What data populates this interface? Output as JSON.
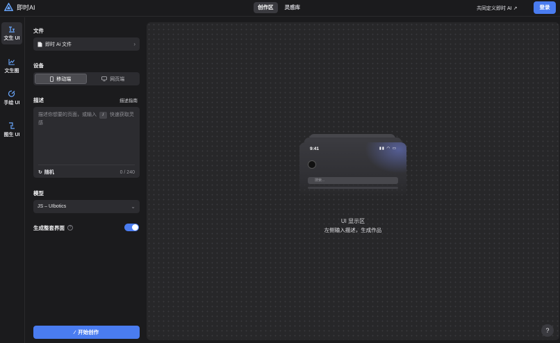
{
  "app": {
    "name": "即时AI"
  },
  "topnav": {
    "tabs": [
      {
        "label": "创作区",
        "active": true
      },
      {
        "label": "灵感库",
        "active": false
      }
    ]
  },
  "header": {
    "custom_link": "共同定义即时 AI",
    "login_label": "登录"
  },
  "rail": {
    "items": [
      {
        "label": "文生 UI",
        "icon": "text-to-ui-icon",
        "active": true
      },
      {
        "label": "文生图",
        "icon": "image-gen-icon",
        "active": false
      },
      {
        "label": "手绘 UI",
        "icon": "sketch-icon",
        "active": false
      },
      {
        "label": "图生 UI",
        "icon": "image-to-ui-icon",
        "active": false
      }
    ]
  },
  "panel": {
    "file": {
      "title": "文件",
      "value": "即时 Ai 文件"
    },
    "device": {
      "title": "设备",
      "options": [
        {
          "label": "移动端",
          "active": true
        },
        {
          "label": "网页端",
          "active": false
        }
      ]
    },
    "description": {
      "title": "描述",
      "guide": "描述指南",
      "placeholder_before": "描述你想要的页面，或输入",
      "shortcut_key": "/",
      "placeholder_after": "快速获取灵感",
      "random_label": "随机",
      "counter": "0 / 240"
    },
    "model": {
      "title": "模型",
      "value": "JS – UIbotics"
    },
    "full_interface": {
      "label": "生成整套界面",
      "enabled": true
    },
    "start_button": "开始创作"
  },
  "canvas": {
    "phone": {
      "time": "9:41",
      "search_placeholder": "搜索..."
    },
    "title": "UI 显示区",
    "subtitle": "左侧输入描述，生成作品"
  },
  "help_label": "?"
}
